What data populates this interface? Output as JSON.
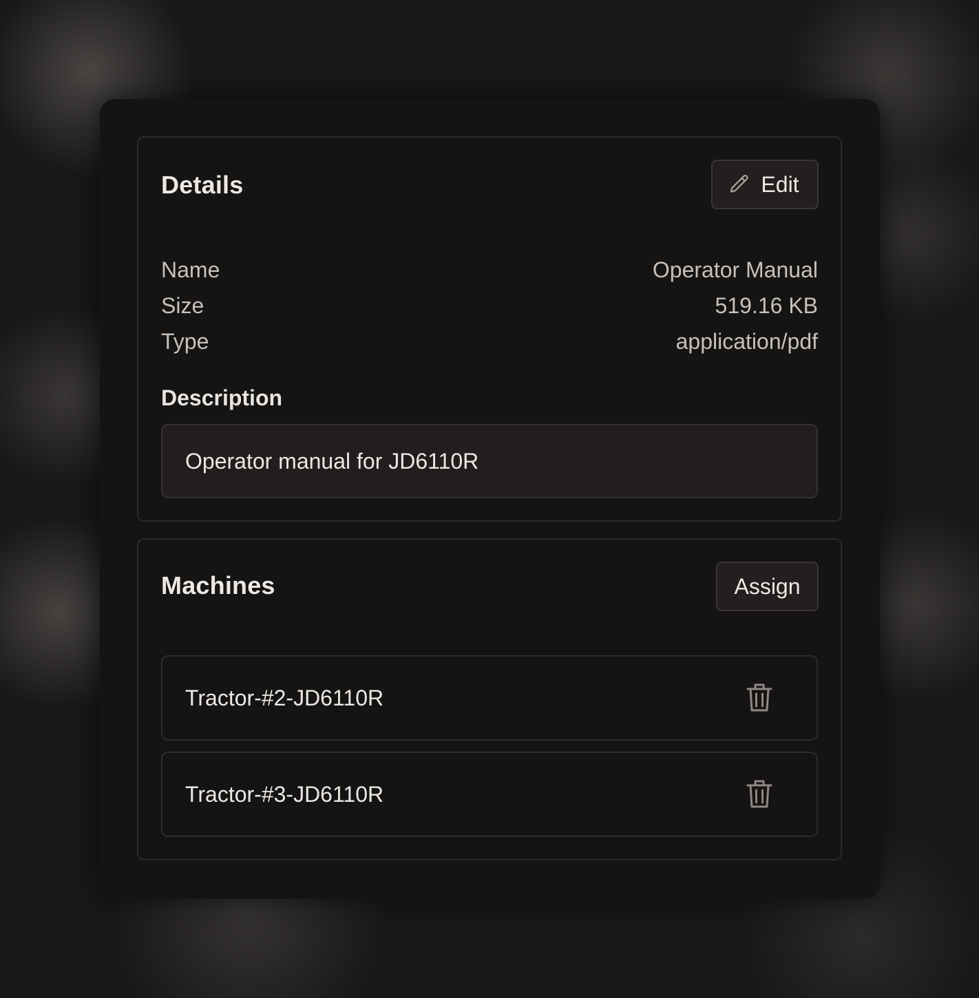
{
  "details": {
    "title": "Details",
    "edit_label": "Edit",
    "fields": [
      {
        "label": "Name",
        "value": "Operator Manual"
      },
      {
        "label": "Size",
        "value": "519.16 KB"
      },
      {
        "label": "Type",
        "value": "application/pdf"
      }
    ],
    "description_label": "Description",
    "description_value": "Operator manual for JD6110R"
  },
  "machines": {
    "title": "Machines",
    "assign_label": "Assign",
    "items": [
      {
        "name": "Tractor-#2-JD6110R",
        "action_icon": "trash-icon"
      },
      {
        "name": "Tractor-#3-JD6110R",
        "action_icon": "trash-icon"
      }
    ]
  },
  "icons": {
    "edit": "pencil-icon",
    "delete": "trash-icon"
  },
  "colors": {
    "background": "#1a1817",
    "panel": "#151413",
    "border": "#2d2a28",
    "text": "#ece8e5",
    "muted_text": "#c6c1bd"
  }
}
